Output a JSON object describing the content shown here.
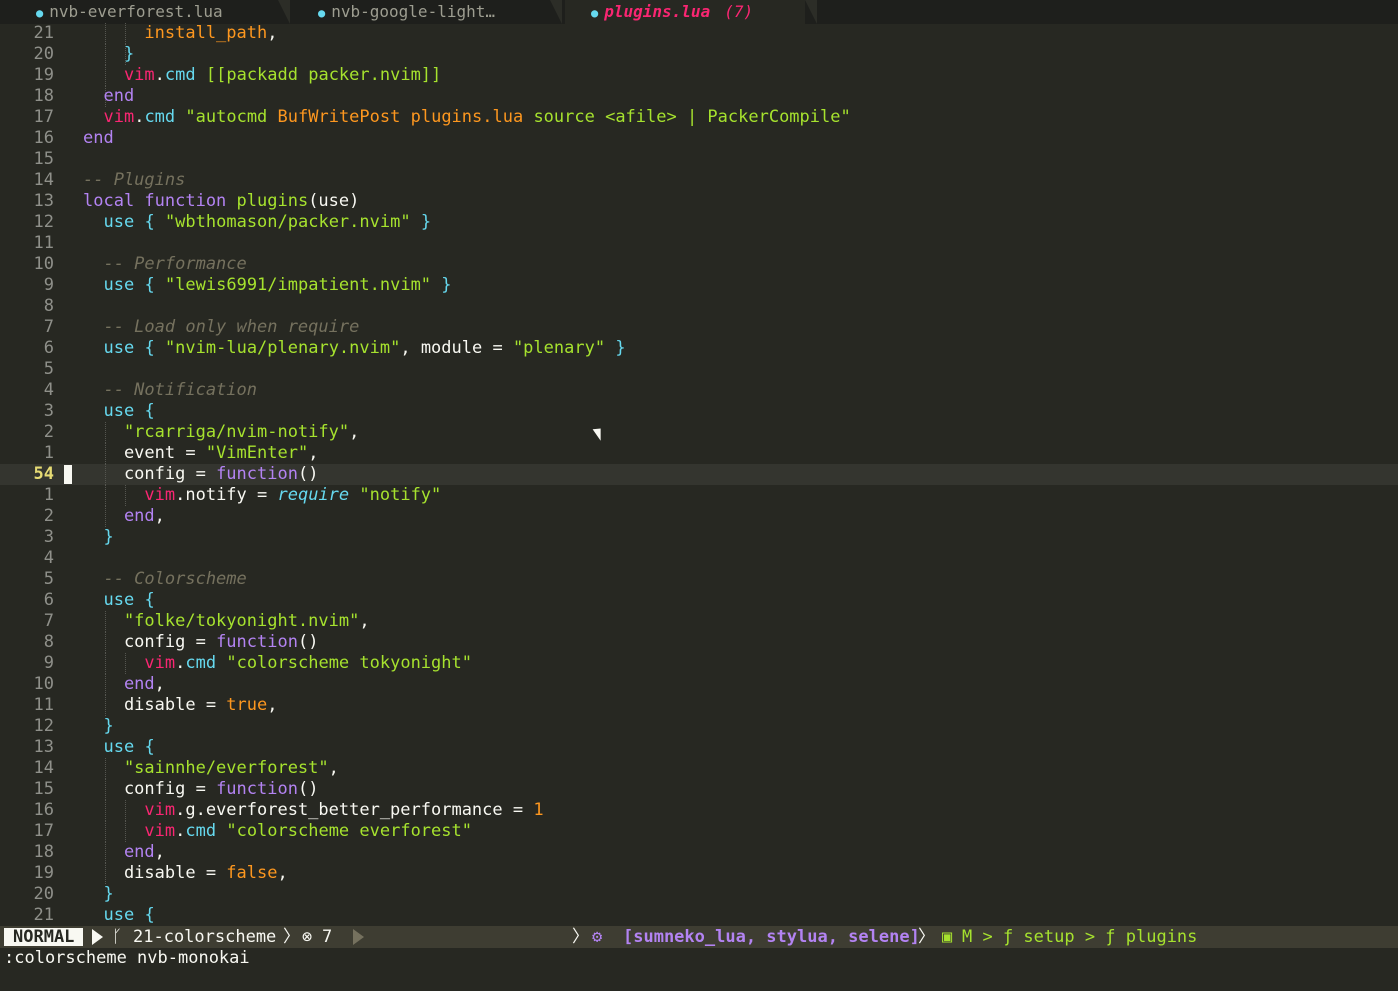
{
  "tabs": [
    {
      "name": "nvb-everforest.lua",
      "active": false
    },
    {
      "name": "nvb-google-light…",
      "active": false
    },
    {
      "name": "plugins.lua",
      "active": true,
      "count": "(7)"
    }
  ],
  "editor": {
    "lines": [
      {
        "ln": "21",
        "indent": [
          1,
          2
        ],
        "segs": [
          [
            "fld",
            "      install_path"
          ],
          [
            "plain",
            ","
          ]
        ]
      },
      {
        "ln": "20",
        "indent": [
          1,
          2
        ],
        "segs": [
          [
            "pun",
            "    }"
          ]
        ]
      },
      {
        "ln": "19",
        "indent": [
          1
        ],
        "segs": [
          [
            "vim",
            "    vim"
          ],
          [
            "plain",
            "."
          ],
          [
            "id",
            "cmd"
          ],
          [
            "plain",
            " "
          ],
          [
            "str",
            "[[packadd packer.nvim]]"
          ]
        ]
      },
      {
        "ln": "18",
        "indent": [
          1
        ],
        "segs": [
          [
            "kw",
            "  end"
          ]
        ]
      },
      {
        "ln": "17",
        "indent": [],
        "segs": [
          [
            "vim",
            "  vim"
          ],
          [
            "plain",
            "."
          ],
          [
            "id",
            "cmd"
          ],
          [
            "plain",
            " "
          ],
          [
            "str",
            "\"autocmd "
          ],
          [
            "orn",
            "BufWritePost"
          ],
          [
            "str",
            " "
          ],
          [
            "fld",
            "plugins.lua"
          ],
          [
            "str",
            " source <afile> | PackerCompile\""
          ]
        ]
      },
      {
        "ln": "16",
        "indent": [],
        "segs": [
          [
            "kw",
            "end"
          ]
        ]
      },
      {
        "ln": "15",
        "indent": [],
        "segs": []
      },
      {
        "ln": "14",
        "indent": [],
        "segs": [
          [
            "cmt",
            "-- Plugins"
          ]
        ]
      },
      {
        "ln": "13",
        "indent": [],
        "segs": [
          [
            "kw",
            "local function "
          ],
          [
            "fn",
            "plugins"
          ],
          [
            "plain",
            "(use)"
          ]
        ]
      },
      {
        "ln": "12",
        "indent": [],
        "segs": [
          [
            "id",
            "  use"
          ],
          [
            "plain",
            " "
          ],
          [
            "pun",
            "{"
          ],
          [
            "plain",
            " "
          ],
          [
            "str",
            "\"wbthomason/packer.nvim\""
          ],
          [
            "plain",
            " "
          ],
          [
            "pun",
            "}"
          ]
        ]
      },
      {
        "ln": "11",
        "indent": [],
        "segs": []
      },
      {
        "ln": "10",
        "indent": [],
        "segs": [
          [
            "cmt",
            "  -- Performance"
          ]
        ]
      },
      {
        "ln": "9",
        "indent": [],
        "segs": [
          [
            "id",
            "  use"
          ],
          [
            "plain",
            " "
          ],
          [
            "pun",
            "{"
          ],
          [
            "plain",
            " "
          ],
          [
            "str",
            "\"lewis6991/impatient.nvim\""
          ],
          [
            "plain",
            " "
          ],
          [
            "pun",
            "}"
          ]
        ]
      },
      {
        "ln": "8",
        "indent": [],
        "segs": []
      },
      {
        "ln": "7",
        "indent": [],
        "segs": [
          [
            "cmt",
            "  -- Load only when require"
          ]
        ]
      },
      {
        "ln": "6",
        "indent": [],
        "segs": [
          [
            "id",
            "  use"
          ],
          [
            "plain",
            " "
          ],
          [
            "pun",
            "{"
          ],
          [
            "plain",
            " "
          ],
          [
            "str",
            "\"nvim-lua/plenary.nvim\""
          ],
          [
            "plain",
            ", module = "
          ],
          [
            "str",
            "\"plenary\""
          ],
          [
            "plain",
            " "
          ],
          [
            "pun",
            "}"
          ]
        ]
      },
      {
        "ln": "5",
        "indent": [],
        "segs": []
      },
      {
        "ln": "4",
        "indent": [],
        "segs": [
          [
            "cmt",
            "  -- Notification"
          ]
        ]
      },
      {
        "ln": "3",
        "indent": [],
        "segs": [
          [
            "id",
            "  use"
          ],
          [
            "plain",
            " "
          ],
          [
            "pun",
            "{"
          ]
        ]
      },
      {
        "ln": "2",
        "indent": [
          1
        ],
        "segs": [
          [
            "str",
            "    \"rcarriga/nvim-notify\""
          ],
          [
            "plain",
            ","
          ]
        ]
      },
      {
        "ln": "1",
        "indent": [
          1
        ],
        "segs": [
          [
            "plain",
            "    event = "
          ],
          [
            "str",
            "\"VimEnter\""
          ],
          [
            "plain",
            ","
          ]
        ]
      },
      {
        "ln": "54",
        "indent": [
          1
        ],
        "cursor": true,
        "segs": [
          [
            "plain",
            "    config = "
          ],
          [
            "kw",
            "function"
          ],
          [
            "plain",
            "()"
          ]
        ]
      },
      {
        "ln": "1",
        "indent": [
          1,
          2
        ],
        "segs": [
          [
            "vim",
            "      vim"
          ],
          [
            "plain",
            ".notify = "
          ],
          [
            "req",
            "require"
          ],
          [
            "plain",
            " "
          ],
          [
            "str",
            "\"notify\""
          ]
        ]
      },
      {
        "ln": "2",
        "indent": [
          1
        ],
        "segs": [
          [
            "kw",
            "    end"
          ],
          [
            "plain",
            ","
          ]
        ]
      },
      {
        "ln": "3",
        "indent": [],
        "segs": [
          [
            "pun",
            "  }"
          ]
        ]
      },
      {
        "ln": "4",
        "indent": [],
        "segs": []
      },
      {
        "ln": "5",
        "indent": [],
        "segs": [
          [
            "cmt",
            "  -- Colorscheme"
          ]
        ]
      },
      {
        "ln": "6",
        "indent": [],
        "segs": [
          [
            "id",
            "  use"
          ],
          [
            "plain",
            " "
          ],
          [
            "pun",
            "{"
          ]
        ]
      },
      {
        "ln": "7",
        "indent": [
          1
        ],
        "segs": [
          [
            "str",
            "    \"folke/tokyonight.nvim\""
          ],
          [
            "plain",
            ","
          ]
        ]
      },
      {
        "ln": "8",
        "indent": [
          1
        ],
        "segs": [
          [
            "plain",
            "    config = "
          ],
          [
            "kw",
            "function"
          ],
          [
            "plain",
            "()"
          ]
        ]
      },
      {
        "ln": "9",
        "indent": [
          1,
          2
        ],
        "segs": [
          [
            "vim",
            "      vim"
          ],
          [
            "plain",
            "."
          ],
          [
            "id",
            "cmd"
          ],
          [
            "plain",
            " "
          ],
          [
            "str",
            "\"colorscheme tokyonight\""
          ]
        ]
      },
      {
        "ln": "10",
        "indent": [
          1
        ],
        "segs": [
          [
            "kw",
            "    end"
          ],
          [
            "plain",
            ","
          ]
        ]
      },
      {
        "ln": "11",
        "indent": [
          1
        ],
        "segs": [
          [
            "plain",
            "    disable = "
          ],
          [
            "bool",
            "true"
          ],
          [
            "plain",
            ","
          ]
        ]
      },
      {
        "ln": "12",
        "indent": [],
        "segs": [
          [
            "pun",
            "  }"
          ]
        ]
      },
      {
        "ln": "13",
        "indent": [],
        "segs": [
          [
            "id",
            "  use"
          ],
          [
            "plain",
            " "
          ],
          [
            "pun",
            "{"
          ]
        ]
      },
      {
        "ln": "14",
        "indent": [
          1
        ],
        "segs": [
          [
            "str",
            "    \"sainnhe/everforest\""
          ],
          [
            "plain",
            ","
          ]
        ]
      },
      {
        "ln": "15",
        "indent": [
          1
        ],
        "segs": [
          [
            "plain",
            "    config = "
          ],
          [
            "kw",
            "function"
          ],
          [
            "plain",
            "()"
          ]
        ]
      },
      {
        "ln": "16",
        "indent": [
          1,
          2
        ],
        "segs": [
          [
            "vim",
            "      vim"
          ],
          [
            "plain",
            ".g.everforest_better_performance = "
          ],
          [
            "num",
            "1"
          ]
        ]
      },
      {
        "ln": "17",
        "indent": [
          1,
          2
        ],
        "segs": [
          [
            "vim",
            "      vim"
          ],
          [
            "plain",
            "."
          ],
          [
            "id",
            "cmd"
          ],
          [
            "plain",
            " "
          ],
          [
            "str",
            "\"colorscheme everforest\""
          ]
        ]
      },
      {
        "ln": "18",
        "indent": [
          1
        ],
        "segs": [
          [
            "kw",
            "    end"
          ],
          [
            "plain",
            ","
          ]
        ]
      },
      {
        "ln": "19",
        "indent": [
          1
        ],
        "segs": [
          [
            "plain",
            "    disable = "
          ],
          [
            "bool",
            "false"
          ],
          [
            "plain",
            ","
          ]
        ]
      },
      {
        "ln": "20",
        "indent": [],
        "segs": [
          [
            "pun",
            "  }"
          ]
        ]
      },
      {
        "ln": "21",
        "indent": [],
        "segs": [
          [
            "id",
            "  use"
          ],
          [
            "plain",
            " "
          ],
          [
            "pun",
            "{"
          ]
        ]
      }
    ]
  },
  "status": {
    "mode": "NORMAL",
    "branch": "21-colorscheme",
    "errors": "7",
    "lsp": "[sumneko_lua, stylua, selene]",
    "breadcrumb": "M > ƒ setup > ƒ plugins"
  },
  "cmdline": ":colorscheme nvb-monokai",
  "colors": {
    "background": "#272822",
    "accent": "#f92672",
    "string": "#a6e22e",
    "keyword": "#b383f2",
    "comment": "#75715e"
  }
}
